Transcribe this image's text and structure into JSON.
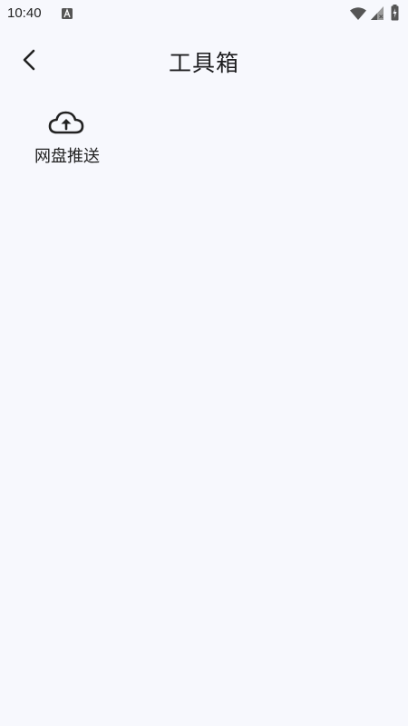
{
  "status_bar": {
    "time": "10:40",
    "icons": [
      "notification-a-icon",
      "wifi-icon",
      "signal-icon",
      "battery-icon"
    ]
  },
  "app_bar": {
    "back_icon": "chevron-left-icon",
    "title": "工具箱"
  },
  "tools": [
    {
      "icon": "cloud-upload-icon",
      "label": "网盘推送"
    }
  ],
  "colors": {
    "background": "#f7f8fd",
    "text": "#1d1d1f"
  }
}
